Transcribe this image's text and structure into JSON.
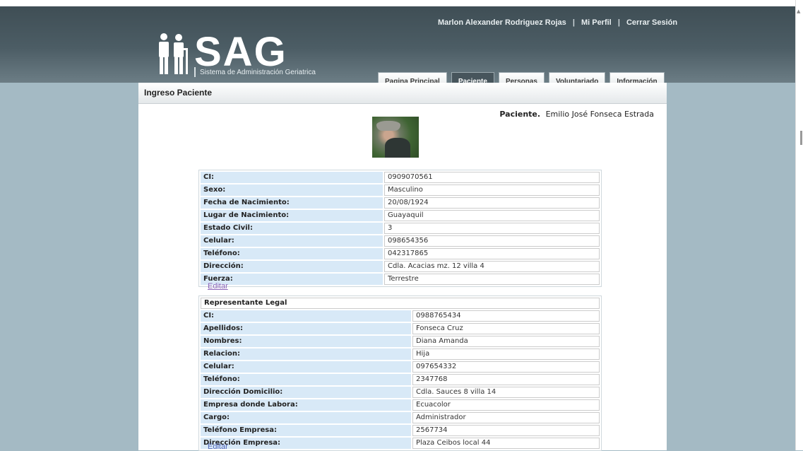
{
  "header": {
    "user_name": "Marlon Alexander Rodriguez Rojas",
    "separator": "|",
    "profile_link": "Mi Perfil",
    "logout_link": "Cerrar Sesión",
    "logo_text": "SAG",
    "logo_subtitle": "Sistema de Administración Geriatrica"
  },
  "tabs": [
    {
      "label": "Pagina Principal",
      "active": false
    },
    {
      "label": "Paciente",
      "active": true
    },
    {
      "label": "Personas",
      "active": false
    },
    {
      "label": "Voluntariado",
      "active": false
    },
    {
      "label": "Información",
      "active": false
    }
  ],
  "page_title": "Ingreso Paciente",
  "patient": {
    "label": "Paciente.",
    "name": "Emilio José Fonseca Estrada"
  },
  "patient_fields": [
    {
      "label": "CI:",
      "value": "0909070561"
    },
    {
      "label": "Sexo:",
      "value": "Masculino"
    },
    {
      "label": "Fecha de Nacimiento:",
      "value": "20/08/1924"
    },
    {
      "label": "Lugar de Nacimiento:",
      "value": "Guayaquil"
    },
    {
      "label": "Estado Civil:",
      "value": "3"
    },
    {
      "label": "Celular:",
      "value": "098654356"
    },
    {
      "label": "Teléfono:",
      "value": "042317865"
    },
    {
      "label": "Dirección:",
      "value": "Cdla. Acacias mz. 12 villa 4"
    },
    {
      "label": "Fuerza:",
      "value": "Terrestre"
    }
  ],
  "edit_label_1": "Editar",
  "representative": {
    "heading": "Representante Legal",
    "fields": [
      {
        "label": "CI:",
        "value": "0988765434"
      },
      {
        "label": "Apellidos:",
        "value": "Fonseca Cruz"
      },
      {
        "label": "Nombres:",
        "value": "Diana Amanda"
      },
      {
        "label": "Relacion:",
        "value": "Hija"
      },
      {
        "label": "Celular:",
        "value": "097654332"
      },
      {
        "label": "Teléfono:",
        "value": "2347768"
      },
      {
        "label": "Dirección Domicilio:",
        "value": "Cdla. Sauces 8 villa 14"
      },
      {
        "label": "Empresa donde Labora:",
        "value": "Ecuacolor"
      },
      {
        "label": "Cargo:",
        "value": "Administrador"
      },
      {
        "label": "Teléfono Empresa:",
        "value": "2567734"
      },
      {
        "label": "Dirección Empresa:",
        "value": "Plaza Ceibos local 44"
      }
    ]
  },
  "edit_label_2": "Editar"
}
